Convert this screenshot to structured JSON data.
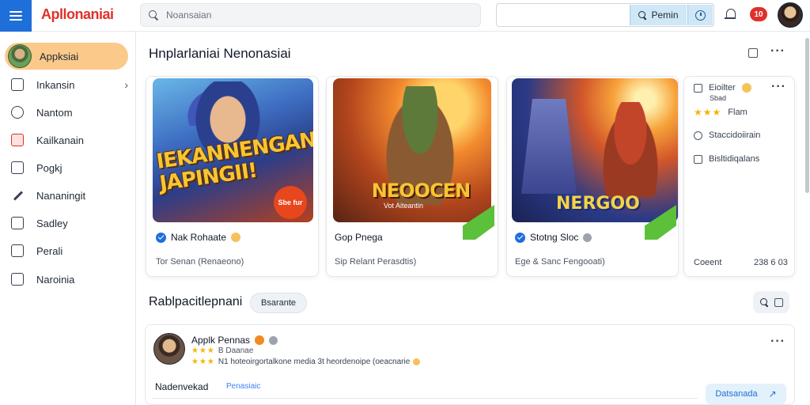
{
  "app": {
    "logo": "Apllonaniai",
    "search_placeholder": "Noansaian",
    "right_search_label": "Pemin",
    "notification_badge": "10",
    "brand_color": "#e0302b",
    "accent_color": "#1e6fd9"
  },
  "sidebar": {
    "active_label": "Appksiai",
    "items": [
      {
        "label": "Inkansin",
        "icon": "download-icon"
      },
      {
        "label": "Nantom",
        "icon": "clock-icon"
      },
      {
        "label": "Kailkanain",
        "icon": "grid-icon"
      },
      {
        "label": "Pogkj",
        "icon": "clipboard-icon"
      },
      {
        "label": "Nananingit",
        "icon": "pen-icon"
      },
      {
        "label": "Sadley",
        "icon": "square-icon"
      },
      {
        "label": "Perali",
        "icon": "upload-icon"
      },
      {
        "label": "Naroinia",
        "icon": "tag-icon"
      }
    ]
  },
  "main": {
    "title": "Hnplarlaniai Nenonasiai",
    "cards": [
      {
        "art_text": "IEKANNENGAN JAPINGII!",
        "badge": "Sbe fur",
        "name": "Nak Rohaate",
        "meta": "Tor Senan (Renaeono)"
      },
      {
        "art_text": "NEOOCEN",
        "art_sub": "Vot Aiteantin",
        "name": "Gop Pnega",
        "meta": "Sip Relant Perasdtis)"
      },
      {
        "art_text": "NERGOO",
        "name": "Stotng Sloc",
        "meta": "Ege & Sanc Fengooati)"
      }
    ],
    "info_card": {
      "title": "Eioilter",
      "subtitle": "Sbad",
      "stars": "★★★",
      "rating_label": "Flam",
      "rows": [
        "Staccidoiirain",
        "Bisltidiqalans"
      ],
      "footer_label": "Coeent",
      "footer_value": "238 6 03"
    }
  },
  "section2": {
    "title": "Rablpacitlepnani",
    "chip": "Bsarante",
    "review": {
      "name": "Applk Pennas",
      "sub_stars": "★★★",
      "sub_text": "B Daanae",
      "body_stars": "★★★",
      "body": "N1 hoteoirgortalkone media 3t heordenoipe (oeacnarie",
      "label": "Nadenvekad",
      "link": "Penasiaic",
      "button": "Datsanada"
    }
  }
}
